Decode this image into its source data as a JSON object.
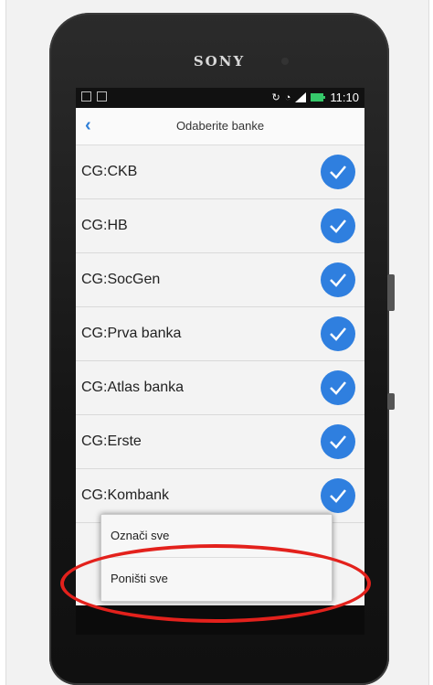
{
  "device": {
    "brand": "SONY"
  },
  "status_bar": {
    "time": "11:10"
  },
  "app_bar": {
    "title": "Odaberite banke"
  },
  "banks": [
    {
      "label": "CG:CKB",
      "checked": true
    },
    {
      "label": "CG:HB",
      "checked": true
    },
    {
      "label": "CG:SocGen",
      "checked": true
    },
    {
      "label": "CG:Prva banka",
      "checked": true
    },
    {
      "label": "CG:Atlas banka",
      "checked": true
    },
    {
      "label": "CG:Erste",
      "checked": true
    },
    {
      "label": "CG:Kombank",
      "checked": true
    }
  ],
  "context_menu": {
    "select_all": "Označi sve",
    "deselect_all": "Poništi sve"
  },
  "colors": {
    "accent": "#2f7fdf",
    "highlight": "#e3211c"
  }
}
